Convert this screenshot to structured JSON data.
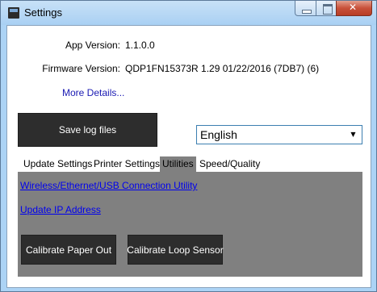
{
  "window": {
    "title": "Settings",
    "icon": "printer-app-icon"
  },
  "info": {
    "app_version_label": "App Version:",
    "app_version_value": "1.1.0.0",
    "firmware_version_label": "Firmware Version:",
    "firmware_version_value": "QDP1FN15373R 1.29 01/22/2016  (7DB7) (6)",
    "more_details_link": "More Details..."
  },
  "actions": {
    "save_log_label": "Save log files"
  },
  "language": {
    "selected": "English"
  },
  "tabs": [
    {
      "label": "Update Settings"
    },
    {
      "label": "Printer Settings"
    },
    {
      "label": "Utilities",
      "active": true
    },
    {
      "label": "Speed/Quality"
    }
  ],
  "utilities": {
    "connection_link": "Wireless/Ethernet/USB Connection Utility",
    "update_ip_link": "Update IP Address",
    "calibrate_paper_label": "Calibrate Paper Out",
    "calibrate_loop_label": "Calibrate Loop Sensor"
  },
  "colors": {
    "title_bar": "#acd3f5",
    "dark_button": "#2d2d2d",
    "panel_bg": "#808080",
    "link": "#0000ee"
  }
}
